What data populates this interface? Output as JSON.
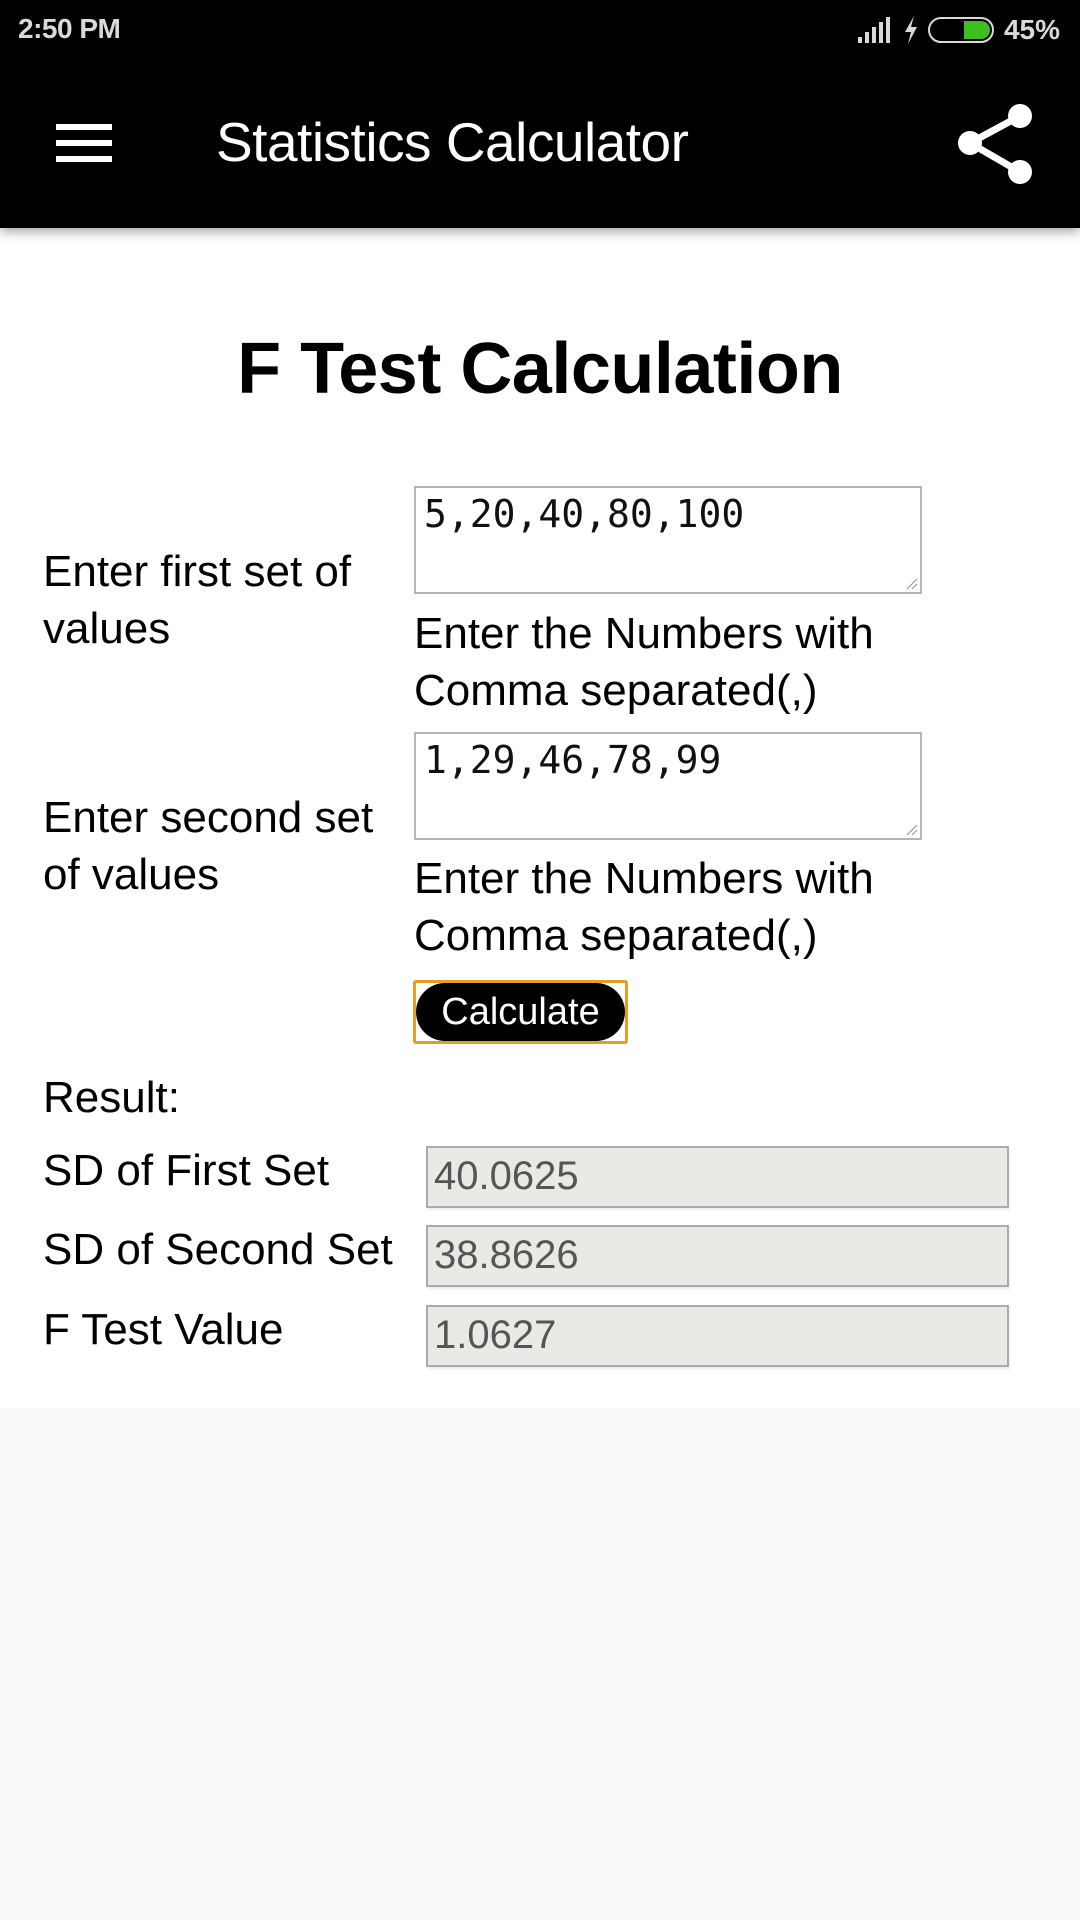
{
  "status_bar": {
    "time": "2:50 PM",
    "battery_percent_label": "45%",
    "battery_level": 0.45,
    "battery_color": "#3fbf1e",
    "icons": [
      "signal-icon",
      "charging-bolt-icon",
      "battery-icon"
    ]
  },
  "app_bar": {
    "title": "Statistics Calculator",
    "menu_icon": "hamburger-menu-icon",
    "share_icon": "share-icon"
  },
  "page": {
    "title": "F Test Calculation",
    "first_set": {
      "label": "Enter first set of values",
      "value": "5,20,40,80,100",
      "hint": "Enter the Numbers with Comma separated(,)"
    },
    "second_set": {
      "label": "Enter second set of values",
      "value": "1,29,46,78,99",
      "hint": "Enter the Numbers with Comma separated(,)"
    },
    "calculate_label": "Calculate",
    "focus_outline_color": "#e0a020",
    "result_heading": "Result:",
    "results": [
      {
        "label": "SD of First Set",
        "value": "40.0625"
      },
      {
        "label": "SD of Second Set",
        "value": "38.8626"
      },
      {
        "label": "F Test Value",
        "value": "1.0627"
      }
    ]
  }
}
